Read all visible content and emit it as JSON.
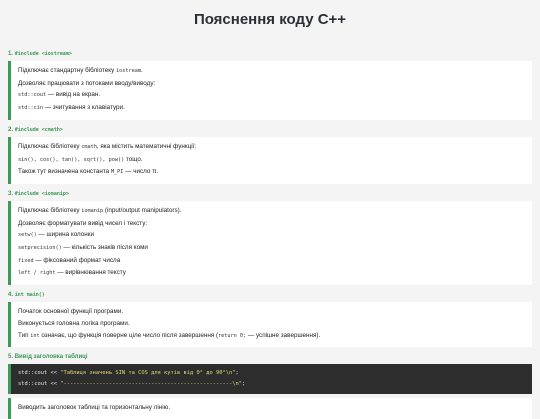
{
  "title": "Пояснення коду C++",
  "sections": [
    {
      "num": "1.",
      "code": "#include <iostream>",
      "lines": [
        {
          "pre": "Підключає стандартну бібліотеку ",
          "code": "iostream",
          "post": "."
        },
        {
          "pre": "Дозволяє працювати з потоками вводу/виводу:",
          "code": "",
          "post": ""
        },
        {
          "pre": "",
          "code": "std::cout",
          "post": " — вивід на екран."
        },
        {
          "pre": "",
          "code": "std::cin",
          "post": " — зчитування з клавіатури."
        }
      ]
    },
    {
      "num": "2.",
      "code": "#include <cmath>",
      "lines": [
        {
          "pre": "Підключає бібліотеку ",
          "code": "cmath",
          "post": ", яка містить математичні функції:"
        },
        {
          "pre": "",
          "code": "sin(), cos(), tan(), sqrt(), pow()",
          "post": " тощо."
        },
        {
          "pre": "Також тут визначена константа ",
          "code": "M_PI",
          "post": " — число π."
        }
      ]
    },
    {
      "num": "3.",
      "code": "#include <iomanip>",
      "lines": [
        {
          "pre": "Підключає бібліотеку ",
          "code": "iomanip",
          "post": " (input/output manipulators)."
        },
        {
          "pre": "Дозволяє форматувати вивід чисел і тексту:",
          "code": "",
          "post": ""
        },
        {
          "pre": "",
          "code": "setw()",
          "post": " — ширина колонки"
        },
        {
          "pre": "",
          "code": "setprecision()",
          "post": " — кількість знаків після коми"
        },
        {
          "pre": "",
          "code": "fixed",
          "post": " — фіксований формат числа"
        },
        {
          "pre": "",
          "code": "left / right",
          "post": " — вирівнювання тексту"
        }
      ]
    },
    {
      "num": "4.",
      "code": "int main()",
      "lines": [
        {
          "pre": "Початок основної функції програми.",
          "code": "",
          "post": ""
        },
        {
          "pre": "Виконується головна логіка програми.",
          "code": "",
          "post": ""
        },
        {
          "pre": "Тип ",
          "code": "int",
          "post": " означає, що функція поверне ціле число після завершення (",
          "code2": "return 0;",
          "post2": " — успішне завершення)."
        }
      ]
    }
  ],
  "section5": {
    "num": "5.",
    "label": "Вивід заголовка таблиці",
    "code_lines": [
      {
        "pre": "std::cout << ",
        "str": "\"Таблиця значень SIN та COS для кутів від 0° до 90°\\n\"",
        "post": ";"
      },
      {
        "pre": "std::cout << ",
        "str": "\"----------------------------------------------------\\n\"",
        "post": ";"
      }
    ],
    "after": "Виводить заголовок таблиці та горизонтальну лінію."
  }
}
